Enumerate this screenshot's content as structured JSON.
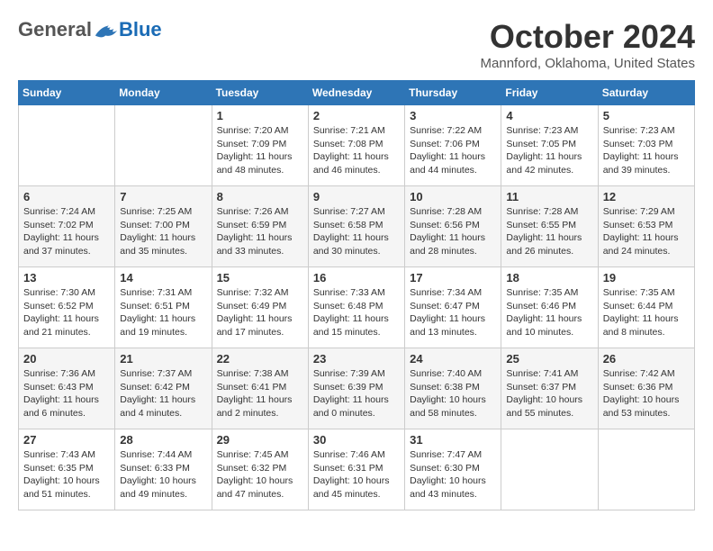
{
  "logo": {
    "general": "General",
    "blue": "Blue"
  },
  "title": "October 2024",
  "location": "Mannford, Oklahoma, United States",
  "weekdays": [
    "Sunday",
    "Monday",
    "Tuesday",
    "Wednesday",
    "Thursday",
    "Friday",
    "Saturday"
  ],
  "weeks": [
    [
      {
        "day": "",
        "sunrise": "",
        "sunset": "",
        "daylight": ""
      },
      {
        "day": "",
        "sunrise": "",
        "sunset": "",
        "daylight": ""
      },
      {
        "day": "1",
        "sunrise": "Sunrise: 7:20 AM",
        "sunset": "Sunset: 7:09 PM",
        "daylight": "Daylight: 11 hours and 48 minutes."
      },
      {
        "day": "2",
        "sunrise": "Sunrise: 7:21 AM",
        "sunset": "Sunset: 7:08 PM",
        "daylight": "Daylight: 11 hours and 46 minutes."
      },
      {
        "day": "3",
        "sunrise": "Sunrise: 7:22 AM",
        "sunset": "Sunset: 7:06 PM",
        "daylight": "Daylight: 11 hours and 44 minutes."
      },
      {
        "day": "4",
        "sunrise": "Sunrise: 7:23 AM",
        "sunset": "Sunset: 7:05 PM",
        "daylight": "Daylight: 11 hours and 42 minutes."
      },
      {
        "day": "5",
        "sunrise": "Sunrise: 7:23 AM",
        "sunset": "Sunset: 7:03 PM",
        "daylight": "Daylight: 11 hours and 39 minutes."
      }
    ],
    [
      {
        "day": "6",
        "sunrise": "Sunrise: 7:24 AM",
        "sunset": "Sunset: 7:02 PM",
        "daylight": "Daylight: 11 hours and 37 minutes."
      },
      {
        "day": "7",
        "sunrise": "Sunrise: 7:25 AM",
        "sunset": "Sunset: 7:00 PM",
        "daylight": "Daylight: 11 hours and 35 minutes."
      },
      {
        "day": "8",
        "sunrise": "Sunrise: 7:26 AM",
        "sunset": "Sunset: 6:59 PM",
        "daylight": "Daylight: 11 hours and 33 minutes."
      },
      {
        "day": "9",
        "sunrise": "Sunrise: 7:27 AM",
        "sunset": "Sunset: 6:58 PM",
        "daylight": "Daylight: 11 hours and 30 minutes."
      },
      {
        "day": "10",
        "sunrise": "Sunrise: 7:28 AM",
        "sunset": "Sunset: 6:56 PM",
        "daylight": "Daylight: 11 hours and 28 minutes."
      },
      {
        "day": "11",
        "sunrise": "Sunrise: 7:28 AM",
        "sunset": "Sunset: 6:55 PM",
        "daylight": "Daylight: 11 hours and 26 minutes."
      },
      {
        "day": "12",
        "sunrise": "Sunrise: 7:29 AM",
        "sunset": "Sunset: 6:53 PM",
        "daylight": "Daylight: 11 hours and 24 minutes."
      }
    ],
    [
      {
        "day": "13",
        "sunrise": "Sunrise: 7:30 AM",
        "sunset": "Sunset: 6:52 PM",
        "daylight": "Daylight: 11 hours and 21 minutes."
      },
      {
        "day": "14",
        "sunrise": "Sunrise: 7:31 AM",
        "sunset": "Sunset: 6:51 PM",
        "daylight": "Daylight: 11 hours and 19 minutes."
      },
      {
        "day": "15",
        "sunrise": "Sunrise: 7:32 AM",
        "sunset": "Sunset: 6:49 PM",
        "daylight": "Daylight: 11 hours and 17 minutes."
      },
      {
        "day": "16",
        "sunrise": "Sunrise: 7:33 AM",
        "sunset": "Sunset: 6:48 PM",
        "daylight": "Daylight: 11 hours and 15 minutes."
      },
      {
        "day": "17",
        "sunrise": "Sunrise: 7:34 AM",
        "sunset": "Sunset: 6:47 PM",
        "daylight": "Daylight: 11 hours and 13 minutes."
      },
      {
        "day": "18",
        "sunrise": "Sunrise: 7:35 AM",
        "sunset": "Sunset: 6:46 PM",
        "daylight": "Daylight: 11 hours and 10 minutes."
      },
      {
        "day": "19",
        "sunrise": "Sunrise: 7:35 AM",
        "sunset": "Sunset: 6:44 PM",
        "daylight": "Daylight: 11 hours and 8 minutes."
      }
    ],
    [
      {
        "day": "20",
        "sunrise": "Sunrise: 7:36 AM",
        "sunset": "Sunset: 6:43 PM",
        "daylight": "Daylight: 11 hours and 6 minutes."
      },
      {
        "day": "21",
        "sunrise": "Sunrise: 7:37 AM",
        "sunset": "Sunset: 6:42 PM",
        "daylight": "Daylight: 11 hours and 4 minutes."
      },
      {
        "day": "22",
        "sunrise": "Sunrise: 7:38 AM",
        "sunset": "Sunset: 6:41 PM",
        "daylight": "Daylight: 11 hours and 2 minutes."
      },
      {
        "day": "23",
        "sunrise": "Sunrise: 7:39 AM",
        "sunset": "Sunset: 6:39 PM",
        "daylight": "Daylight: 11 hours and 0 minutes."
      },
      {
        "day": "24",
        "sunrise": "Sunrise: 7:40 AM",
        "sunset": "Sunset: 6:38 PM",
        "daylight": "Daylight: 10 hours and 58 minutes."
      },
      {
        "day": "25",
        "sunrise": "Sunrise: 7:41 AM",
        "sunset": "Sunset: 6:37 PM",
        "daylight": "Daylight: 10 hours and 55 minutes."
      },
      {
        "day": "26",
        "sunrise": "Sunrise: 7:42 AM",
        "sunset": "Sunset: 6:36 PM",
        "daylight": "Daylight: 10 hours and 53 minutes."
      }
    ],
    [
      {
        "day": "27",
        "sunrise": "Sunrise: 7:43 AM",
        "sunset": "Sunset: 6:35 PM",
        "daylight": "Daylight: 10 hours and 51 minutes."
      },
      {
        "day": "28",
        "sunrise": "Sunrise: 7:44 AM",
        "sunset": "Sunset: 6:33 PM",
        "daylight": "Daylight: 10 hours and 49 minutes."
      },
      {
        "day": "29",
        "sunrise": "Sunrise: 7:45 AM",
        "sunset": "Sunset: 6:32 PM",
        "daylight": "Daylight: 10 hours and 47 minutes."
      },
      {
        "day": "30",
        "sunrise": "Sunrise: 7:46 AM",
        "sunset": "Sunset: 6:31 PM",
        "daylight": "Daylight: 10 hours and 45 minutes."
      },
      {
        "day": "31",
        "sunrise": "Sunrise: 7:47 AM",
        "sunset": "Sunset: 6:30 PM",
        "daylight": "Daylight: 10 hours and 43 minutes."
      },
      {
        "day": "",
        "sunrise": "",
        "sunset": "",
        "daylight": ""
      },
      {
        "day": "",
        "sunrise": "",
        "sunset": "",
        "daylight": ""
      }
    ]
  ]
}
